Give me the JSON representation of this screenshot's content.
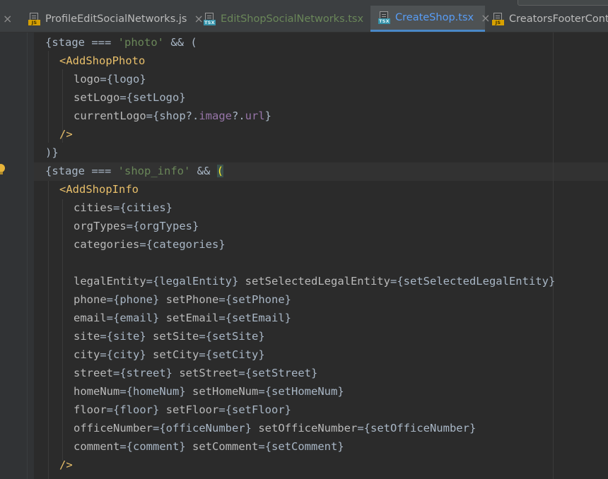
{
  "tabs": [
    {
      "label": "ProfileEditSocialNetworks.js",
      "icon": "js-file-icon",
      "badge": "JS",
      "close": "×",
      "active": false,
      "color": "#bbbbbb"
    },
    {
      "label": "EditShopSocialNetworks.tsx",
      "icon": "tsx-file-icon",
      "badge": "TSX",
      "close": "×",
      "active": false,
      "color": "#6a8759"
    },
    {
      "label": "CreateShop.tsx",
      "icon": "tsx-file-icon",
      "badge": "TSX",
      "close": "×",
      "active": true,
      "color": "#589df6"
    },
    {
      "label": "CreatorsFooterContro",
      "icon": "js-file-icon",
      "badge": "JS",
      "close": "",
      "active": false,
      "color": "#bbbbbb"
    }
  ],
  "left_tab_close": "×",
  "code_lines": [
    {
      "indent": 6,
      "tokens": [
        {
          "t": "{stage ",
          "c": "plain"
        },
        {
          "t": "===",
          "c": "op"
        },
        {
          "t": " ",
          "c": "plain"
        },
        {
          "t": "'photo'",
          "c": "str"
        },
        {
          "t": " && (",
          "c": "plain"
        }
      ]
    },
    {
      "indent": 8,
      "tokens": [
        {
          "t": "<AddShopPhoto",
          "c": "tag"
        }
      ]
    },
    {
      "indent": 10,
      "tokens": [
        {
          "t": "logo",
          "c": "attr"
        },
        {
          "t": "=",
          "c": "op"
        },
        {
          "t": "{logo}",
          "c": "brace"
        }
      ]
    },
    {
      "indent": 10,
      "tokens": [
        {
          "t": "setLogo",
          "c": "attr"
        },
        {
          "t": "=",
          "c": "op"
        },
        {
          "t": "{setLogo}",
          "c": "brace"
        }
      ]
    },
    {
      "indent": 10,
      "tokens": [
        {
          "t": "currentLogo",
          "c": "attr"
        },
        {
          "t": "=",
          "c": "op"
        },
        {
          "t": "{shop?.",
          "c": "brace"
        },
        {
          "t": "image",
          "c": "prop"
        },
        {
          "t": "?.",
          "c": "brace"
        },
        {
          "t": "url",
          "c": "prop"
        },
        {
          "t": "}",
          "c": "brace"
        }
      ]
    },
    {
      "indent": 8,
      "tokens": [
        {
          "t": "/>",
          "c": "tag"
        }
      ]
    },
    {
      "indent": 6,
      "tokens": [
        {
          "t": ")}",
          "c": "plain"
        }
      ]
    },
    {
      "indent": 6,
      "tokens": [
        {
          "t": "{stage ",
          "c": "plain"
        },
        {
          "t": "===",
          "c": "op"
        },
        {
          "t": " ",
          "c": "plain"
        },
        {
          "t": "'shop_info'",
          "c": "str"
        },
        {
          "t": " && ",
          "c": "plain"
        },
        {
          "t": "(",
          "c": "paren-hl"
        }
      ]
    },
    {
      "indent": 8,
      "tokens": [
        {
          "t": "<AddShopInfo",
          "c": "tag"
        }
      ]
    },
    {
      "indent": 10,
      "tokens": [
        {
          "t": "cities",
          "c": "attr"
        },
        {
          "t": "=",
          "c": "op"
        },
        {
          "t": "{cities}",
          "c": "brace"
        }
      ]
    },
    {
      "indent": 10,
      "tokens": [
        {
          "t": "orgTypes",
          "c": "attr"
        },
        {
          "t": "=",
          "c": "op"
        },
        {
          "t": "{orgTypes}",
          "c": "brace"
        }
      ]
    },
    {
      "indent": 10,
      "tokens": [
        {
          "t": "categories",
          "c": "attr"
        },
        {
          "t": "=",
          "c": "op"
        },
        {
          "t": "{categories}",
          "c": "brace"
        }
      ]
    },
    {
      "indent": 0,
      "tokens": []
    },
    {
      "indent": 10,
      "tokens": [
        {
          "t": "legalEntity",
          "c": "attr"
        },
        {
          "t": "=",
          "c": "op"
        },
        {
          "t": "{legalEntity}",
          "c": "brace"
        },
        {
          "t": " ",
          "c": "plain"
        },
        {
          "t": "setSelectedLegalEntity",
          "c": "attr"
        },
        {
          "t": "=",
          "c": "op"
        },
        {
          "t": "{setSelectedLegalEntity}",
          "c": "brace"
        }
      ]
    },
    {
      "indent": 10,
      "tokens": [
        {
          "t": "phone",
          "c": "attr"
        },
        {
          "t": "=",
          "c": "op"
        },
        {
          "t": "{phone}",
          "c": "brace"
        },
        {
          "t": " ",
          "c": "plain"
        },
        {
          "t": "setPhone",
          "c": "attr"
        },
        {
          "t": "=",
          "c": "op"
        },
        {
          "t": "{setPhone}",
          "c": "brace"
        }
      ]
    },
    {
      "indent": 10,
      "tokens": [
        {
          "t": "email",
          "c": "attr"
        },
        {
          "t": "=",
          "c": "op"
        },
        {
          "t": "{email}",
          "c": "brace"
        },
        {
          "t": " ",
          "c": "plain"
        },
        {
          "t": "setEmail",
          "c": "attr"
        },
        {
          "t": "=",
          "c": "op"
        },
        {
          "t": "{setEmail}",
          "c": "brace"
        }
      ]
    },
    {
      "indent": 10,
      "tokens": [
        {
          "t": "site",
          "c": "attr"
        },
        {
          "t": "=",
          "c": "op"
        },
        {
          "t": "{site}",
          "c": "brace"
        },
        {
          "t": " ",
          "c": "plain"
        },
        {
          "t": "setSite",
          "c": "attr"
        },
        {
          "t": "=",
          "c": "op"
        },
        {
          "t": "{setSite}",
          "c": "brace"
        }
      ]
    },
    {
      "indent": 10,
      "tokens": [
        {
          "t": "city",
          "c": "attr"
        },
        {
          "t": "=",
          "c": "op"
        },
        {
          "t": "{city}",
          "c": "brace"
        },
        {
          "t": " ",
          "c": "plain"
        },
        {
          "t": "setCity",
          "c": "attr"
        },
        {
          "t": "=",
          "c": "op"
        },
        {
          "t": "{setCity}",
          "c": "brace"
        }
      ]
    },
    {
      "indent": 10,
      "tokens": [
        {
          "t": "street",
          "c": "attr"
        },
        {
          "t": "=",
          "c": "op"
        },
        {
          "t": "{street}",
          "c": "brace"
        },
        {
          "t": " ",
          "c": "plain"
        },
        {
          "t": "setStreet",
          "c": "attr"
        },
        {
          "t": "=",
          "c": "op"
        },
        {
          "t": "{setStreet}",
          "c": "brace"
        }
      ]
    },
    {
      "indent": 10,
      "tokens": [
        {
          "t": "homeNum",
          "c": "attr"
        },
        {
          "t": "=",
          "c": "op"
        },
        {
          "t": "{homeNum}",
          "c": "brace"
        },
        {
          "t": " ",
          "c": "plain"
        },
        {
          "t": "setHomeNum",
          "c": "attr"
        },
        {
          "t": "=",
          "c": "op"
        },
        {
          "t": "{setHomeNum}",
          "c": "brace"
        }
      ]
    },
    {
      "indent": 10,
      "tokens": [
        {
          "t": "floor",
          "c": "attr"
        },
        {
          "t": "=",
          "c": "op"
        },
        {
          "t": "{floor}",
          "c": "brace"
        },
        {
          "t": " ",
          "c": "plain"
        },
        {
          "t": "setFloor",
          "c": "attr"
        },
        {
          "t": "=",
          "c": "op"
        },
        {
          "t": "{setFloor}",
          "c": "brace"
        }
      ]
    },
    {
      "indent": 10,
      "tokens": [
        {
          "t": "officeNumber",
          "c": "attr"
        },
        {
          "t": "=",
          "c": "op"
        },
        {
          "t": "{officeNumber}",
          "c": "brace"
        },
        {
          "t": " ",
          "c": "plain"
        },
        {
          "t": "setOfficeNumber",
          "c": "attr"
        },
        {
          "t": "=",
          "c": "op"
        },
        {
          "t": "{setOfficeNumber}",
          "c": "brace"
        }
      ]
    },
    {
      "indent": 10,
      "tokens": [
        {
          "t": "comment",
          "c": "attr"
        },
        {
          "t": "=",
          "c": "op"
        },
        {
          "t": "{comment}",
          "c": "brace"
        },
        {
          "t": " ",
          "c": "plain"
        },
        {
          "t": "setComment",
          "c": "attr"
        },
        {
          "t": "=",
          "c": "op"
        },
        {
          "t": "{setComment}",
          "c": "brace"
        }
      ]
    },
    {
      "indent": 8,
      "tokens": [
        {
          "t": "/>",
          "c": "tag"
        }
      ]
    }
  ],
  "colors": {
    "editor_bg": "#2b2b2b",
    "tag": "#e8bf6a",
    "string": "#6a8759",
    "property": "#9876aa",
    "text": "#a9b7c6",
    "active_tab_underline": "#4a88c7"
  }
}
